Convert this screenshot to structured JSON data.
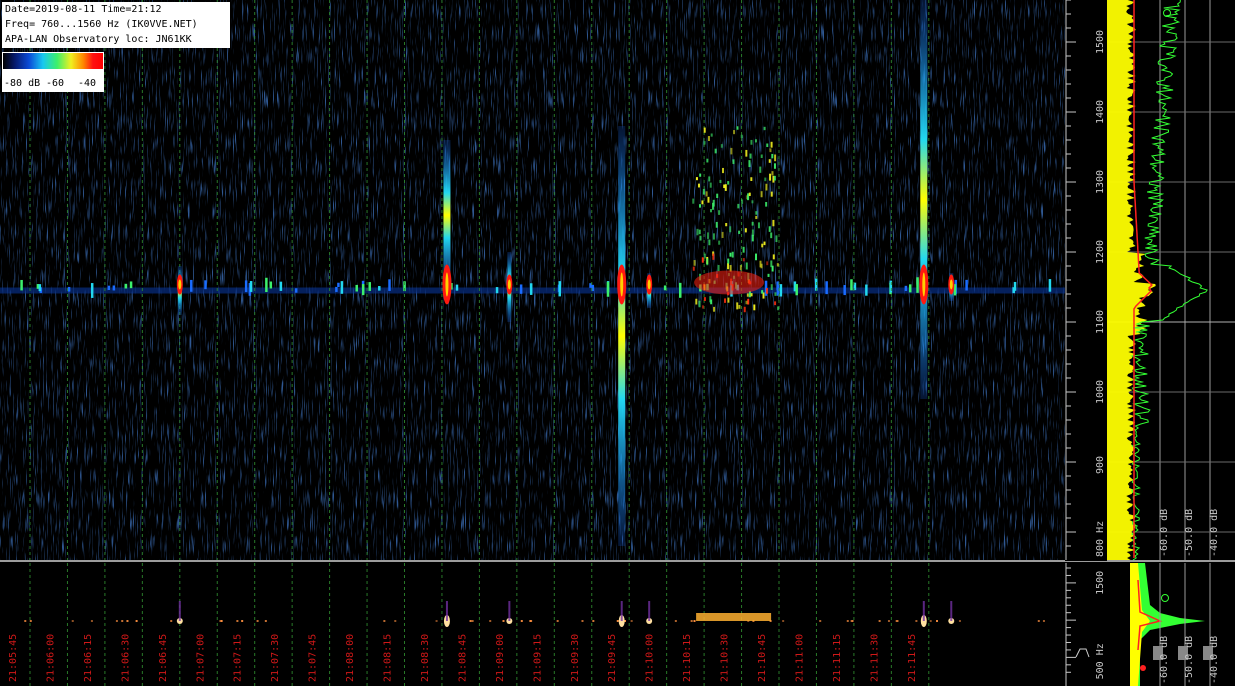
{
  "header": {
    "line1": "Date=2019-08-11 Time=21:12",
    "line2": "Freq= 760...1560 Hz (IK0VVE.NET)",
    "line3": "APA-LAN Observatory loc: JN61KK"
  },
  "colorbar": {
    "labels": [
      "-80 dB",
      "-60",
      "-40"
    ]
  },
  "colors": {
    "background": "#000000",
    "grid_time": "#2f8f2f",
    "time_label": "#d01818",
    "freq_label": "#c8c8c8",
    "yellow_spectrum": "#ffff00",
    "green_spectrum": "#33ff33",
    "red_average": "#ff2020"
  },
  "chart_data": [
    {
      "type": "heatmap",
      "name": "waterfall-spectrogram",
      "y_unit": "Hz",
      "y_ticks": [
        800,
        900,
        1000,
        1100,
        1200,
        1300,
        1400,
        1500
      ],
      "ylim": [
        760,
        1560
      ],
      "x_ticks": [
        "21:05:45",
        "21:06:00",
        "21:06:15",
        "21:06:30",
        "21:06:45",
        "21:07:00",
        "21:07:15",
        "21:07:30",
        "21:07:45",
        "21:08:00",
        "21:08:15",
        "21:08:30",
        "21:08:45",
        "21:09:00",
        "21:09:15",
        "21:09:30",
        "21:09:45",
        "21:10:00",
        "21:10:15",
        "21:10:30",
        "21:10:45",
        "21:11:00",
        "21:11:15",
        "21:11:30",
        "21:11:45"
      ],
      "carrier_hz": 1145,
      "color_scale_db": [
        -80,
        -40
      ],
      "events": [
        {
          "time": "21:08:32",
          "fmin": 1145,
          "fmax": 1360,
          "level": "strong"
        },
        {
          "time": "21:08:57",
          "fmin": 1100,
          "fmax": 1200,
          "level": "medium"
        },
        {
          "time": "21:09:42",
          "fmin": 780,
          "fmax": 1380,
          "level": "strong"
        },
        {
          "time": "21:09:53",
          "fmin": 1120,
          "fmax": 1170,
          "level": "medium"
        },
        {
          "time": "21:10:15",
          "fmin": 1120,
          "fmax": 1380,
          "level": "burst"
        },
        {
          "time": "21:11:43",
          "fmin": 990,
          "fmax": 1560,
          "level": "strong"
        },
        {
          "time": "21:06:45",
          "fmin": 1110,
          "fmax": 1180,
          "level": "medium"
        },
        {
          "time": "21:11:54",
          "fmin": 1130,
          "fmax": 1170,
          "level": "medium"
        }
      ]
    },
    {
      "type": "line",
      "name": "spectrum-profile",
      "x_ticks": [
        "-60.0 dB",
        "-50.0 dB",
        "-40.0 dB"
      ],
      "y_unit": "Hz",
      "y_ticks": [
        800,
        900,
        1000,
        1100,
        1200,
        1300,
        1400,
        1500
      ],
      "series": [
        {
          "color": "#ffff00"
        },
        {
          "color": "#33ff33"
        },
        {
          "color": "#ff2020"
        }
      ]
    },
    {
      "type": "heatmap",
      "name": "overview-strip",
      "y_unit": "Hz",
      "y_ticks": [
        500,
        1500
      ],
      "x_ticks": [
        "-60.0 dB",
        "-50.0 dB",
        "-40.0 dB"
      ]
    }
  ]
}
